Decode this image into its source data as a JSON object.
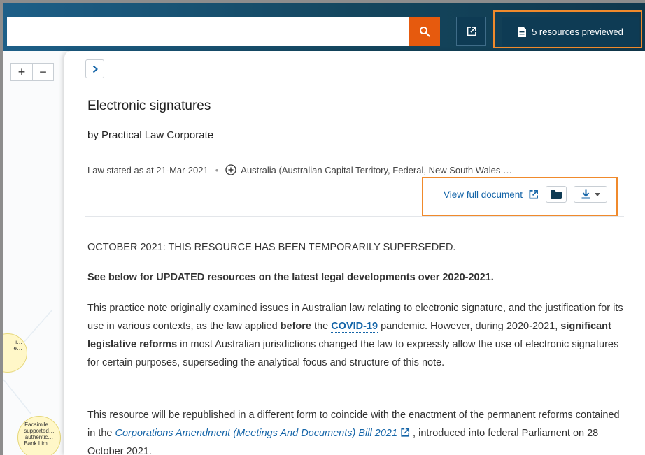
{
  "header": {
    "search_value": "",
    "preview_label": "5 resources previewed",
    "search_icon": "search-icon",
    "external_icon": "external-link-icon",
    "document_icon": "document-icon"
  },
  "graph": {
    "zoom_in": "+",
    "zoom_out": "−",
    "nodes": [
      {
        "text": "i…\ne…\n…"
      },
      {
        "text": "Facsimile…\nsupported…\nauthentic…\nBank Limi…"
      }
    ]
  },
  "document": {
    "title": "Electronic signatures",
    "author": "by Practical Law Corporate",
    "law_stated": "Law stated as at 21-Mar-2021",
    "separator": "•",
    "jurisdiction": "Australia (Australian Capital Territory, Federal, New South Wales …",
    "view_full_label": "View full document",
    "notice": "OCTOBER 2021: THIS RESOURCE HAS BEEN TEMPORARILY SUPERSEDED.",
    "updated_note": "See below for UPDATED resources on the latest legal developments over 2020-2021.",
    "para1": {
      "a": "This practice note originally examined issues in Australian law relating to electronic signature, and the justification for its use in various contexts, as the law applied ",
      "b": "before",
      "c": " the ",
      "link": "COVID-19",
      "d": " pandemic. However, during 2020-2021, ",
      "e": "significant legislative reforms",
      "f": " in most Australian jurisdictions changed the law to expressly allow the use of electronic signatures for certain purposes, superseding the analytical focus and structure of this note."
    },
    "para2": {
      "a": "This resource will be republished in a different form to coincide with the enactment of the permanent reforms contained in the ",
      "link": "Corporations Amendment (Meetings And Documents) Bill 2021",
      "b": " , introduced into federal Parliament on 28 October 2021."
    }
  },
  "colors": {
    "accent_orange": "#e65a0e",
    "highlight_orange": "#f08a2c",
    "header_blue": "#14465e",
    "link_blue": "#1565a8"
  }
}
